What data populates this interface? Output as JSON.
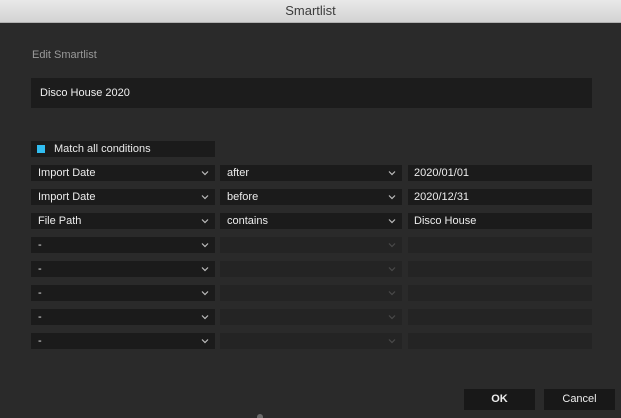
{
  "window": {
    "title": "Smartlist"
  },
  "editor": {
    "section_label": "Edit Smartlist",
    "name_value": "Disco House 2020",
    "match_all_label": "Match all conditions",
    "match_all_checked": true
  },
  "conditions": [
    {
      "field": "Import Date",
      "operator": "after",
      "value": "2020/01/01",
      "enabled": true
    },
    {
      "field": "Import Date",
      "operator": "before",
      "value": "2020/12/31",
      "enabled": true
    },
    {
      "field": "File Path",
      "operator": "contains",
      "value": "Disco House",
      "enabled": true
    },
    {
      "field": "-",
      "operator": "",
      "value": "",
      "enabled": false
    },
    {
      "field": "-",
      "operator": "",
      "value": "",
      "enabled": false
    },
    {
      "field": "-",
      "operator": "",
      "value": "",
      "enabled": false
    },
    {
      "field": "-",
      "operator": "",
      "value": "",
      "enabled": false
    },
    {
      "field": "-",
      "operator": "",
      "value": "",
      "enabled": false
    }
  ],
  "buttons": {
    "ok_label": "OK",
    "cancel_label": "Cancel"
  },
  "colors": {
    "accent": "#31bdf0",
    "background": "#2a2a2a",
    "field_bg": "#1b1b1b"
  },
  "icons": {
    "dropdown": "chevron-down-icon"
  }
}
